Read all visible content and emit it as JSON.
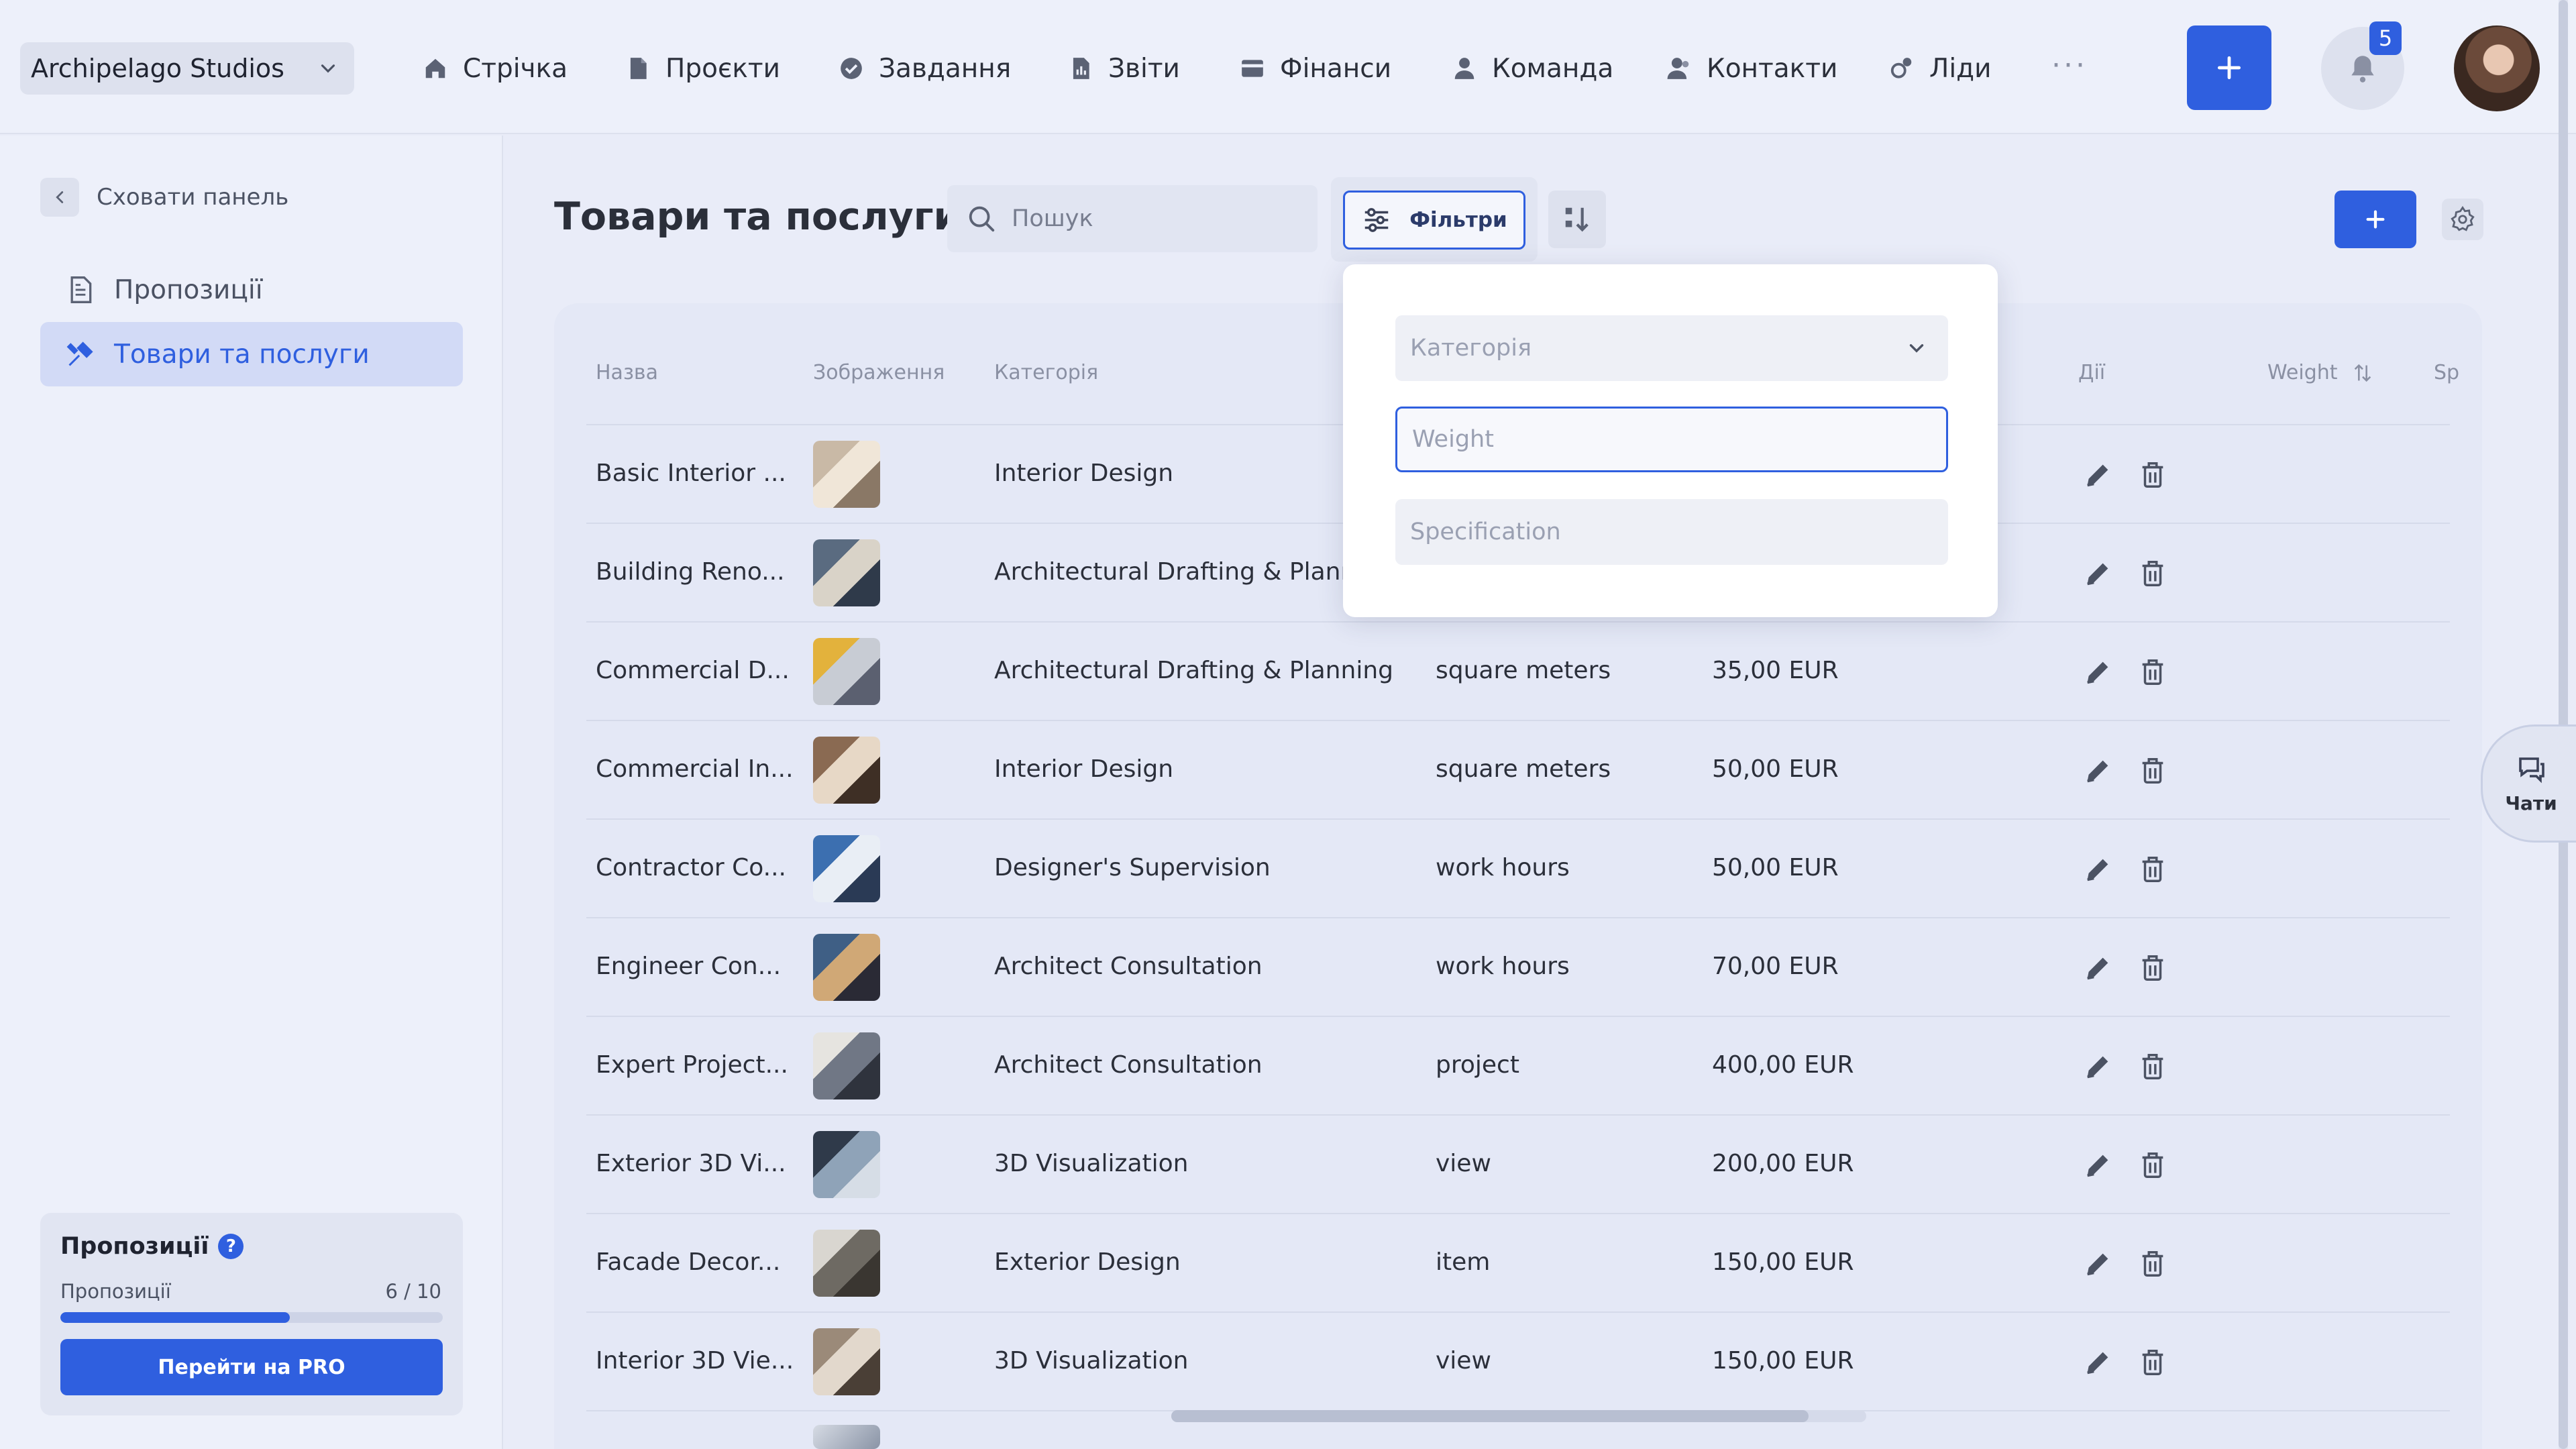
{
  "topbar": {
    "company": "Archipelago Studios",
    "nav": [
      {
        "label": "Стрічка",
        "icon": "home-icon"
      },
      {
        "label": "Проєкти",
        "icon": "document-icon"
      },
      {
        "label": "Завдання",
        "icon": "check-circle-icon"
      },
      {
        "label": "Звіти",
        "icon": "report-icon"
      },
      {
        "label": "Фінанси",
        "icon": "wallet-icon"
      },
      {
        "label": "Команда",
        "icon": "person-icon"
      },
      {
        "label": "Контакти",
        "icon": "contacts-icon"
      },
      {
        "label": "Ліди",
        "icon": "leads-icon"
      }
    ],
    "more": "···",
    "notifications_count": "5"
  },
  "sidebar": {
    "hide_label": "Сховати панель",
    "items": [
      {
        "label": "Пропозиції",
        "icon": "document-icon",
        "active": false
      },
      {
        "label": "Товари та послуги",
        "icon": "tools-icon",
        "active": true
      }
    ],
    "promo": {
      "title": "Пропозиції",
      "help": "?",
      "label": "Пропозиції",
      "count": "6 / 10",
      "progress": 0.6,
      "button": "Перейти на PRO"
    }
  },
  "main": {
    "title": "Товари та послуги",
    "search_placeholder": "Пошук",
    "filters_label": "Фільтри",
    "columns": {
      "name": "Назва",
      "image": "Зображення",
      "category": "Категорія",
      "actions": "Дії",
      "weight": "Weight",
      "spec": "Sp"
    },
    "rows": [
      {
        "name": "Basic Interior ...",
        "category": "Interior Design",
        "unit": "",
        "price": ""
      },
      {
        "name": "Building Reno...",
        "category": "Architectural Drafting & Plannin",
        "unit": "",
        "price": ""
      },
      {
        "name": "Commercial D...",
        "category": "Architectural Drafting & Planning",
        "unit": "square meters",
        "price": "35,00 EUR"
      },
      {
        "name": "Commercial In...",
        "category": "Interior Design",
        "unit": "square meters",
        "price": "50,00 EUR"
      },
      {
        "name": "Contractor Co...",
        "category": "Designer's Supervision",
        "unit": "work hours",
        "price": "50,00 EUR"
      },
      {
        "name": "Engineer Con...",
        "category": "Architect Consultation",
        "unit": "work hours",
        "price": "70,00 EUR"
      },
      {
        "name": "Expert Project...",
        "category": "Architect Consultation",
        "unit": "project",
        "price": "400,00 EUR"
      },
      {
        "name": "Exterior 3D Vi...",
        "category": "3D Visualization",
        "unit": "view",
        "price": "200,00 EUR"
      },
      {
        "name": "Facade Decor...",
        "category": "Exterior Design",
        "unit": "item",
        "price": "150,00 EUR"
      },
      {
        "name": "Interior 3D Vie...",
        "category": "3D Visualization",
        "unit": "view",
        "price": "150,00 EUR"
      }
    ]
  },
  "filter_popup": {
    "category_placeholder": "Категорія",
    "weight_placeholder": "Weight",
    "spec_placeholder": "Specification"
  },
  "chats_label": "Чати",
  "colors": {
    "accent": "#2f5fdf",
    "background": "#e9ecf8",
    "card": "#e4e8f6"
  }
}
